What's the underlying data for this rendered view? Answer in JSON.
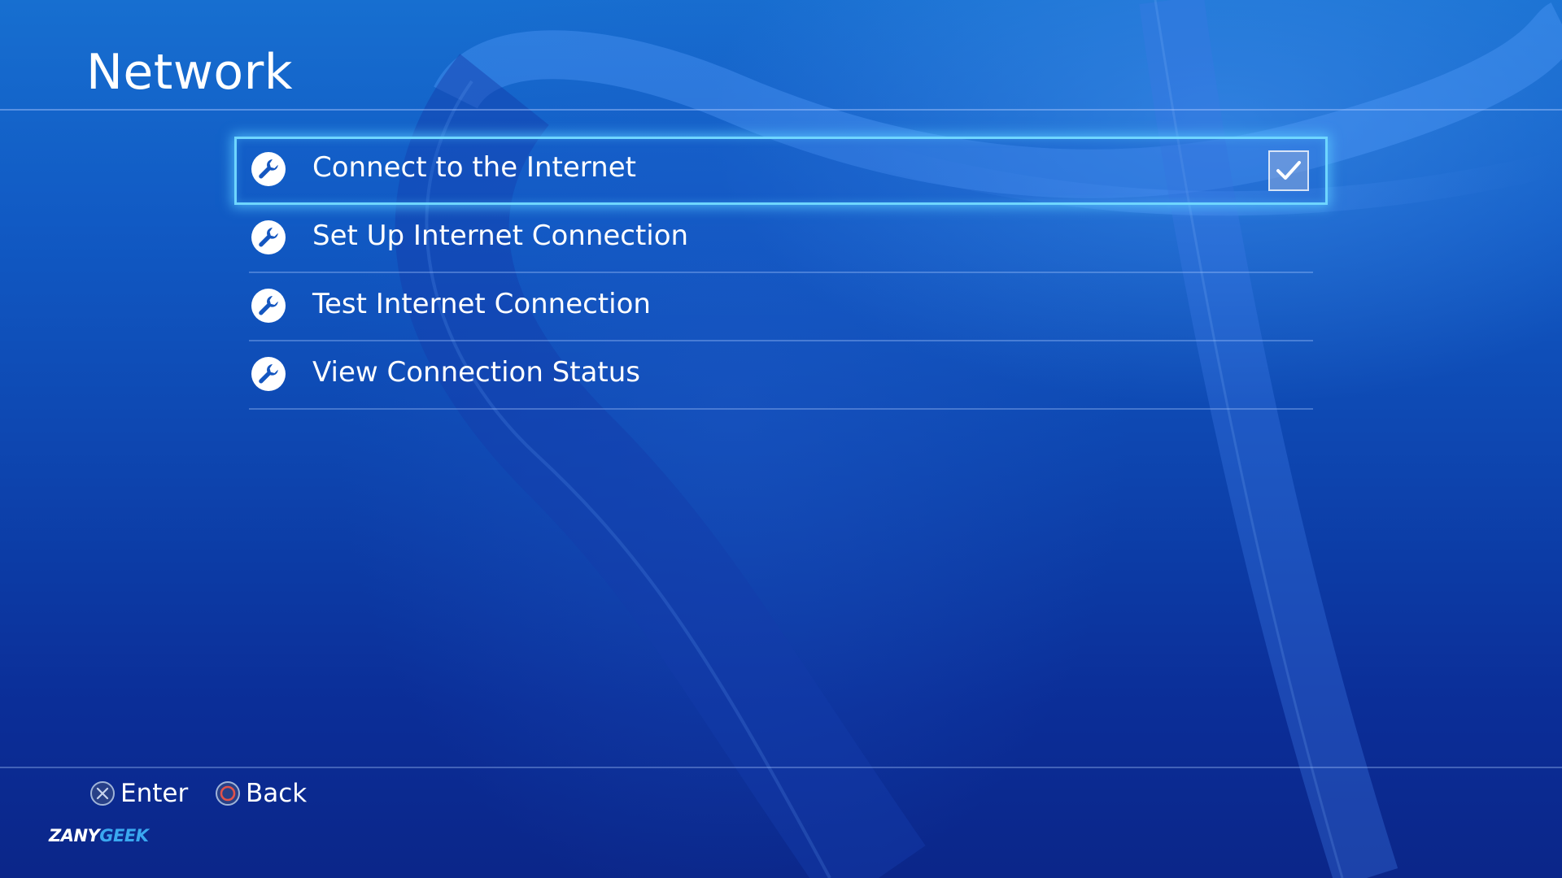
{
  "header": {
    "title": "Network"
  },
  "menu": {
    "items": [
      {
        "label": "Connect to the Internet",
        "icon": "wrench-icon",
        "selected": true,
        "checked": true
      },
      {
        "label": "Set Up Internet Connection",
        "icon": "wrench-icon",
        "selected": false
      },
      {
        "label": "Test Internet Connection",
        "icon": "wrench-icon",
        "selected": false
      },
      {
        "label": "View Connection Status",
        "icon": "wrench-icon",
        "selected": false
      }
    ]
  },
  "footer": {
    "enter": {
      "label": "Enter",
      "icon": "cross-button-icon"
    },
    "back": {
      "label": "Back",
      "icon": "circle-button-icon"
    }
  },
  "watermark": {
    "part1": "ZANY",
    "part2": "GEEK"
  },
  "colors": {
    "selection_glow": "#6fd6ff",
    "background_top": "#176fd0",
    "background_bottom": "#0b2689",
    "circle_button": "#e0524a"
  }
}
